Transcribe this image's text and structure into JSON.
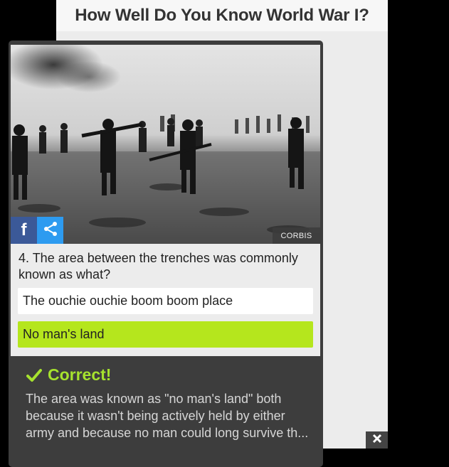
{
  "header": {
    "title": "How Well Do You Know World War I?"
  },
  "photo": {
    "credit": "CORBIS",
    "share_facebook_glyph": "f"
  },
  "question": {
    "text": "4. The area between the trenches was commonly known as what?",
    "answers": [
      {
        "label": "The ouchie ouchie boom boom place",
        "state": "normal"
      },
      {
        "label": "No man's land",
        "state": "correct"
      }
    ]
  },
  "result": {
    "title": "Correct!",
    "explanation": "The area was known as \"no man's land\" both because it wasn't being actively held by either army and because no man could long survive th..."
  },
  "colors": {
    "correct_answer_bg": "#b5e61d",
    "correct_title": "#a6e22e",
    "facebook": "#3b5998",
    "share": "#2d9bf0",
    "card_dark": "#3d3d3d"
  },
  "icons": {
    "facebook": "facebook-icon",
    "share": "share-icon",
    "check": "check-icon",
    "close": "close-icon"
  }
}
